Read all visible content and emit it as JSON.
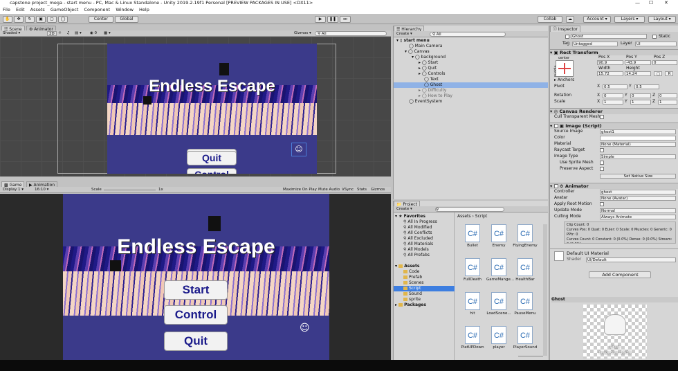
{
  "window": {
    "title": "capstone project_mega - start menu - PC, Mac & Linux Standalone - Unity 2019.2.19f1 Personal [PREVIEW PACKAGES IN USE] <DX11>"
  },
  "menu": [
    "File",
    "Edit",
    "Assets",
    "GameObject",
    "Component",
    "Window",
    "Help"
  ],
  "toolbar": {
    "center": "Center",
    "global": "Global",
    "collab": "Collab",
    "account": "Account",
    "layers": "Layers",
    "layout": "Layout"
  },
  "scene": {
    "tab_scene": "Scene",
    "tab_animator": "Animator",
    "shading": "Shaded",
    "mode2d": "2D",
    "gizmos": "Gizmos",
    "search_all": "All"
  },
  "game": {
    "tab_game": "Game",
    "tab_animation": "Animation",
    "display": "Display 1",
    "aspect": "16:10",
    "scale_label": "Scale",
    "scale_value": "1x",
    "maximize": "Maximize On Play",
    "mute": "Mute Audio",
    "vsync": "VSync",
    "stats": "Stats",
    "gizmos": "Gizmos"
  },
  "gameui": {
    "title": "Endless Escape",
    "start": "Start",
    "control": "Control",
    "quit": "Quit"
  },
  "hierarchy": {
    "tab": "Hierarchy",
    "create": "Create",
    "search": "All",
    "rows": [
      "start menu",
      "Main Camera",
      "Canvas",
      "background",
      "Start",
      "Quit",
      "Controls",
      "Text",
      "Ghost",
      "Difficulty",
      "How to Play",
      "EventSystem"
    ]
  },
  "project": {
    "tab": "Project",
    "create": "Create",
    "favorites_label": "Favorites",
    "favorites": [
      "All In Progress",
      "All Modified",
      "All Conflicts",
      "All Excluded",
      "All Materials",
      "All Models",
      "All Prefabs"
    ],
    "assets_label": "Assets",
    "folders": [
      "Code",
      "Prefab",
      "Scenes",
      "Script",
      "Sound",
      "sprite"
    ],
    "packages_label": "Packages",
    "breadcrumb_root": "Assets",
    "breadcrumb_sep": "›",
    "breadcrumb_leaf": "Script",
    "assets": [
      "Bullet",
      "Enemy",
      "FlyingEnemy",
      "FullDeath",
      "GameMange...",
      "HealthBar",
      "hit",
      "LoadScene...",
      "PauseMenu",
      "PlatUPDown",
      "player",
      "PlayerSound"
    ],
    "icon_text": "C#"
  },
  "inspector": {
    "tab": "Inspector",
    "object_name": "Ghost",
    "static_label": "Static",
    "tag_label": "Tag",
    "tag_value": "Untagged",
    "layer_label": "Layer",
    "layer_value": "UI",
    "rect_transform": "Rect Transform",
    "anchor_mode": "center",
    "side_label": "middle",
    "posx_label": "Pos X",
    "posy_label": "Pos Y",
    "posz_label": "Pos Z",
    "posx": "90.9",
    "posy": "-43.9",
    "posz": "0",
    "width_label": "Width",
    "height_label": "Height",
    "width": "15.72",
    "height": "14.24",
    "anchors": "Anchors",
    "pivot": "Pivot",
    "pivot_x": "0.5",
    "pivot_y": "0.5",
    "rotation": "Rotation",
    "rot_x": "0",
    "rot_y": "0",
    "rot_z": "0",
    "scale": "Scale",
    "scale_x": "1",
    "scale_y": "1",
    "scale_z": "1",
    "x_label": "X",
    "y_label": "Y",
    "z_label": "Z",
    "raw_label": "R",
    "canvas_renderer": "Canvas Renderer",
    "cull_label": "Cull Transparent Mesh",
    "image": "Image (Script)",
    "source_image_label": "Source Image",
    "source_image": "ghost1",
    "color_label": "Color",
    "material_label": "Material",
    "material_value": "None (Material)",
    "raycast_label": "Raycast Target",
    "image_type_label": "Image Type",
    "image_type": "Simple",
    "use_sprite_mesh": "Use Sprite Mesh",
    "preserve_aspect": "Preserve Aspect",
    "set_native": "Set Native Size",
    "animator": "Animator",
    "controller_label": "Controller",
    "controller_value": "ghost",
    "avatar_label": "Avatar",
    "avatar_value": "None (Avatar)",
    "root_motion": "Apply Root Motion",
    "update_mode_label": "Update Mode",
    "update_mode": "Normal",
    "culling_label": "Culling Mode",
    "culling_mode": "Always Animate",
    "info1": "Clip Count: 0",
    "info2": "Curves Pos: 0 Quat: 0 Euler: 0 Scale: 0 Muscles: 0 Generic: 0 PPtr: 0",
    "info3": "Curves Count: 0 Constant: 0 (0.0%) Dense: 0 (0.0%) Stream: 0 (0.0%)",
    "default_material": "Default UI Material",
    "shader_label": "Shader",
    "shader_value": "UI/Default",
    "add_component": "Add Component"
  },
  "preview": {
    "label": "Ghost",
    "caption": "Ghost",
    "caption2": "Image Size: 16x16"
  }
}
